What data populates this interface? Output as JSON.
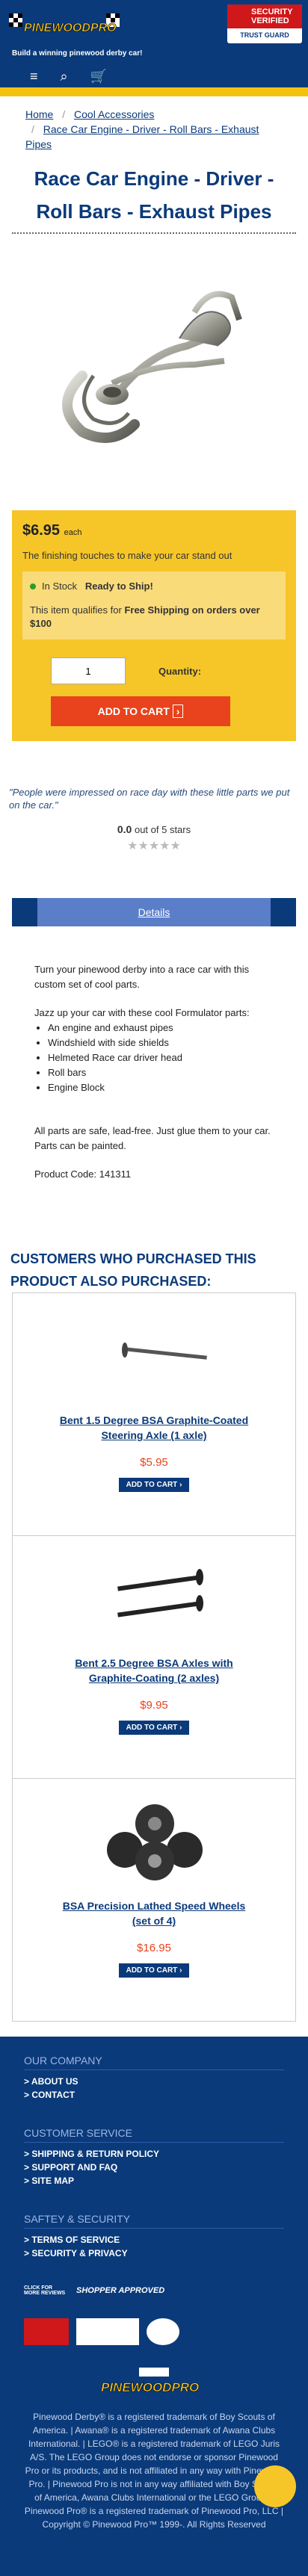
{
  "header": {
    "logo_text": "PINEWOODPRO.com",
    "tagline": "Build a winning pinewood derby car!",
    "badge_top": "SECURITY VERIFIED",
    "badge_bottom": "TRUST GUARD"
  },
  "nav": {
    "menu_icon": "≡",
    "search_icon": "⌕",
    "cart_icon": "🛒"
  },
  "breadcrumb": {
    "home": "Home",
    "category": "Cool Accessories",
    "current": "Race Car Engine - Driver - Roll Bars - Exhaust Pipes",
    "sep": "/"
  },
  "product": {
    "title": "Race Car Engine - Driver - Roll Bars - Exhaust Pipes",
    "price": "$6.95",
    "price_unit": "each",
    "tagline": "The finishing touches to make your car stand out",
    "stock": "In Stock",
    "ready": "Ready to Ship!",
    "shipping_pre": "This item qualifies for ",
    "shipping_bold": "Free Shipping on orders over $100",
    "qty_value": "1",
    "qty_label": "Quantity:",
    "cart_label": "ADD TO CART"
  },
  "review": {
    "quote": "\"People were impressed on race day with these little parts we put on the car.\"",
    "score": "0.0",
    "score_suffix": "out of 5 stars",
    "stars": "★★★★★"
  },
  "tabs": {
    "details": "Details"
  },
  "description": {
    "p1": "Turn your pinewood derby into a race car with this custom set of cool parts.",
    "p2": "Jazz up your car with these cool Formulator parts:",
    "items": [
      "An engine and exhaust pipes",
      "Windshield with side shields",
      "Helmeted Race car driver head",
      "Roll bars",
      "Engine Block"
    ],
    "p3": "All parts are safe, lead-free. Just glue them to your car. Parts can be painted.",
    "code": "Product Code: 141311"
  },
  "also": {
    "heading": "CUSTOMERS WHO PURCHASED THIS PRODUCT ALSO PURCHASED:",
    "items": [
      {
        "name": "Bent 1.5 Degree BSA Graphite-Coated Steering Axle (1 axle)",
        "price": "$5.95",
        "btn": "ADD TO CART"
      },
      {
        "name": "Bent 2.5 Degree BSA Axles with Graphite-Coating (2 axles)",
        "price": "$9.95",
        "btn": "ADD TO CART"
      },
      {
        "name": "BSA Precision Lathed Speed Wheels (set of 4)",
        "price": "$16.95",
        "btn": "ADD TO CART"
      }
    ]
  },
  "footer": {
    "our_company": "OUR COMPANY",
    "about": "> ABOUT US",
    "contact": "> CONTACT",
    "service": "CUSTOMER SERVICE",
    "shipping": "> SHIPPING & RETURN POLICY",
    "support": "> SUPPORT AND FAQ",
    "sitemap": "> SITE MAP",
    "security": "SAFTEY & SECURITY",
    "terms": "> TERMS OF SERVICE",
    "privacy": "> SECURITY & PRIVACY",
    "legal": "Pinewood Derby® is a registered trademark of Boy Scouts of America. | Awana® is a registered trademark of Awana Clubs International. | LEGO® is a registered trademark of LEGO Juris A/S. The LEGO Group does not endorse or sponsor Pinewood Pro or its products, and is not affiliated in any way with Pinewood Pro. | Pinewood Pro is not in any way affiliated with Boy Scouts of America, Awana Clubs International or the LEGO Group. | Pinewood Pro® is a registered trademark of Pinewood Pro, LLC | Copyright © Pinewood Pro™ 1999-. All Rights Reserved",
    "shopper": "SHOPPER APPROVED",
    "click": "CLICK FOR MORE REVIEWS"
  }
}
